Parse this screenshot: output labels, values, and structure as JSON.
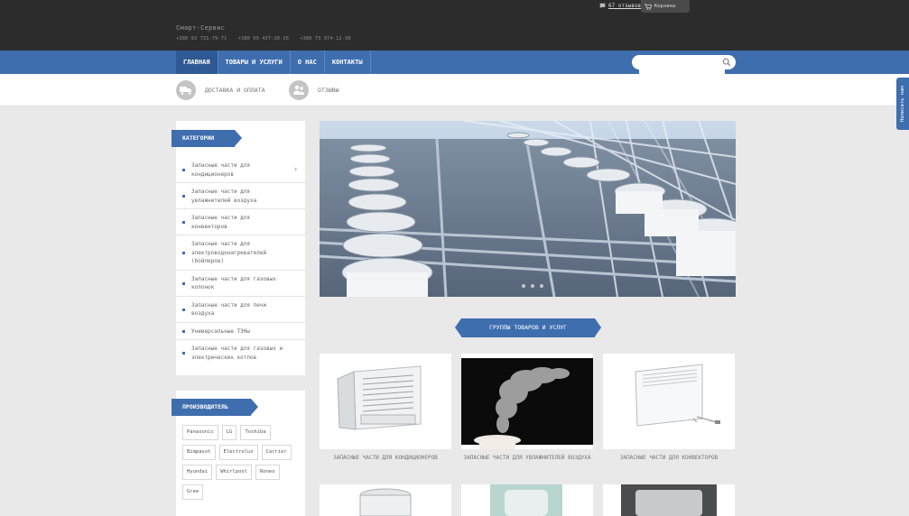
{
  "header": {
    "brand": "Смарт-Сервис",
    "phones": [
      "+380 93 731-79-71",
      "+380 99 437-30-16",
      "+380 73 074-12-98"
    ],
    "reviews_label": "67 отзывов",
    "cart_label": "Корзина"
  },
  "nav": {
    "items": [
      "ГЛАВНАЯ",
      "ТОВАРЫ И УСЛУГИ",
      "О НАС",
      "КОНТАКТЫ"
    ],
    "active": "ГЛАВНАЯ",
    "search_placeholder": ""
  },
  "subnav": {
    "items": [
      "ДОСТАВКА И ОПЛАТА",
      "ОТЗЫВЫ"
    ]
  },
  "feedback_tab": "Написать нам",
  "categories": {
    "title": "КАТЕГОРИИ",
    "items": [
      "Запасные части для кондиционеров",
      "Запасные части для увлажнителей воздуха",
      "Запасные части для конвекторов",
      "Запасные части для электроводонагревателей (бойлеров)",
      "Запасные части для газовых колонок",
      "Запасные части для печи воздуха",
      "Универсальные ТЭНы",
      "Запасные части для газовых и электрических котлов"
    ]
  },
  "manufacturers": {
    "title": "ПРОИЗВОДИТЕЛЬ",
    "items": [
      "Panasonic",
      "LG",
      "Toshiba",
      "Bimpasot",
      "Electrolux",
      "Carrier",
      "Hyundai",
      "Whirlpool",
      "Roneo",
      "Gree"
    ]
  },
  "groups": {
    "title": "ГРУППЫ ТОВАРОВ И УСЛУГ",
    "cards": [
      "ЗАПАСНЫЕ ЧАСТИ ДЛЯ КОНДИЦИОНЕРОВ",
      "ЗАПАСНЫЕ ЧАСТИ ДЛЯ УВЛАЖНИТЕЛЕЙ ВОЗДУХА",
      "ЗАПАСНЫЕ ЧАСТИ ДЛЯ КОНВЕКТОРОВ"
    ]
  },
  "colors": {
    "header_bg": "#2c2c2c",
    "accent": "#3f6eaf",
    "page_bg": "#e9e9e9"
  }
}
